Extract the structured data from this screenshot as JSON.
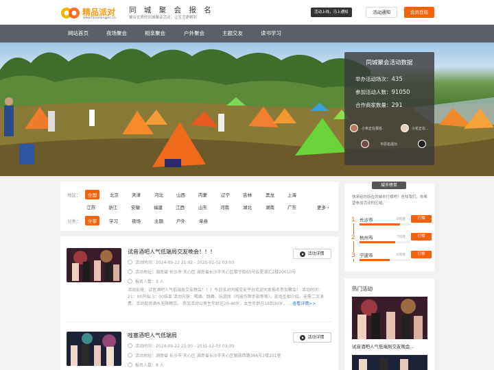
{
  "header": {
    "logo_text": "精品派对",
    "logo_url": "www.faxianjingpin.cn",
    "title": "同 城 聚 会 报 名",
    "subtitle": "聚合优质的同城聚会活动，让生活更精彩",
    "notice_bubble": "活动上线，马上通知",
    "notice_button": "活动通知",
    "login_button": "会员登陆"
  },
  "nav": {
    "items": [
      "网站首页",
      "夜场聚会",
      "相亲聚会",
      "户外聚会",
      "主题交友",
      "读书学习"
    ]
  },
  "stats": {
    "title": "同城聚会活动数据",
    "held_label": "举办活动场次：",
    "held_value": "435",
    "people_label": "参加活动人数：",
    "people_value": "91050",
    "merchants_label": "合作商家数量：",
    "merchants_value": "291",
    "recent": [
      {
        "text": "小米正在报名"
      },
      {
        "text": "小花正在..."
      },
      {
        "text": "平原名成功"
      }
    ]
  },
  "filter": {
    "region_label": "地区：",
    "regions_row1": [
      "全国",
      "北京",
      "天津",
      "河北",
      "山西",
      "内蒙",
      "辽宁",
      "吉林",
      "黑龙",
      "上海"
    ],
    "regions_row2": [
      "江苏",
      "浙江",
      "安徽",
      "福建",
      "江西",
      "山东",
      "河南",
      "湖北",
      "湖南",
      "广东"
    ],
    "more": "更多",
    "category_label": "分类：",
    "categories": [
      "全部",
      "学习",
      "夜场",
      "主题",
      "户外",
      "单身"
    ]
  },
  "activities": [
    {
      "title": "试音酒吧人气低端局交友晚会！！！",
      "time_label": "活动时间：",
      "time": "2024-09-22 21:02  -  2025-01-02 03:00",
      "addr_label": "活动地址：",
      "addr": "湖南省  长沙市  天心区  湖南省长沙市天心区黎子街65号云星湖汇2楼20010号",
      "count_label": "报名人数：",
      "count": "3 人",
      "desc": "活动安排：试音酒吧人气低端局交友晚会！！！今日派对同城交友平台欢迎大家报名参加聚会！ 活动时间：21：00开始-3：00结束 活动内容：喝酒、跳舞、玩游戏（可能作弊手指等等）、现场互相介绍，无需二次消费，活动现场酒水无限畅饮。 参加活动以男生年龄在20-40岁，女生年龄在18到30岁，...",
      "more": "查看详情>>",
      "detail_button": "活动详情"
    },
    {
      "title": "哇塞酒吧人气低端局",
      "time_label": "活动时间：",
      "time": "2024-09-22 21:00  -  2031-12-03 03:00",
      "addr_label": "活动地址：",
      "addr": "湖南省  长沙市  天心区  湖南省长沙市天心区解放西路366号2楼201室",
      "count_label": "报名人数：",
      "count": "8 人",
      "detail_button": "活动详情"
    }
  ],
  "ranking": {
    "tag": "城市榜单",
    "intro": "快来给你所在的城市打榜吧！告知我们，你希望参加活动的区域。",
    "items": [
      {
        "no": "1",
        "city": "长沙市",
        "count": "8热度",
        "fill": 0.8,
        "button": "打榜"
      },
      {
        "no": "2",
        "city": "杭州市",
        "count": "7热度",
        "fill": 0.7,
        "button": "打榜"
      },
      {
        "no": "3",
        "city": "宁波市",
        "count": "6热度",
        "fill": 0.6,
        "button": "打榜"
      }
    ]
  },
  "hot": {
    "title": "热门活动",
    "items": [
      {
        "caption": "试音酒吧人气低端局交友晚会..."
      }
    ]
  },
  "colors": {
    "accent": "#f5620c",
    "nav_bg": "#5c5f66",
    "link": "#2a6fd6"
  }
}
